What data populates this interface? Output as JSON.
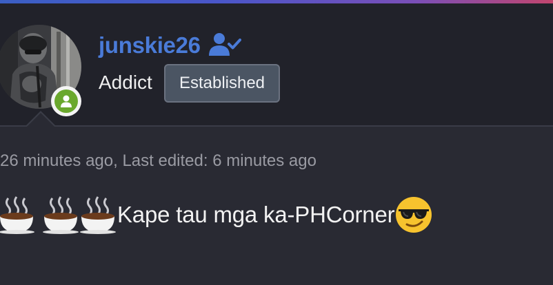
{
  "user": {
    "username": "junskie26",
    "title": "Addict",
    "rank_badge": "Established",
    "username_color": "#4a7bd8",
    "online_status_color": "#6aa82d",
    "icons": {
      "verified": "user-check-icon",
      "status": "user-icon"
    }
  },
  "post": {
    "meta": "26 minutes ago, Last edited: 6 minutes ago",
    "body_text": "Kape tau mga ka-PHCorner",
    "emojis": [
      "hot-beverage-emoji",
      "hot-beverage-emoji",
      "hot-beverage-emoji",
      "smiling-face-with-sunglasses-emoji"
    ]
  },
  "theme": {
    "accent_gradient": [
      "#3b5fc4",
      "#7a4fb8",
      "#c2456e"
    ],
    "background": "#292a33",
    "header_background": "#21222a"
  }
}
